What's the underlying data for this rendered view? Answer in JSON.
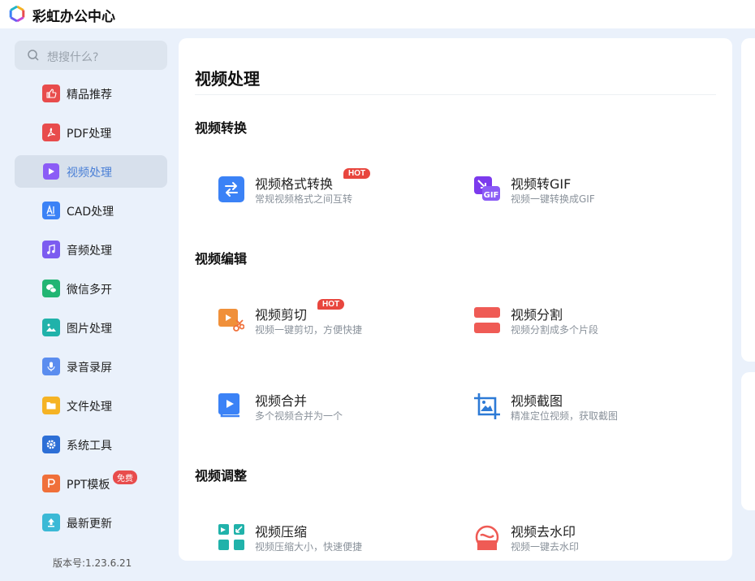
{
  "app": {
    "title": "彩虹办公中心"
  },
  "search": {
    "placeholder": "想搜什么?"
  },
  "sidebar": {
    "items": [
      {
        "label": "精品推荐",
        "icon": "thumbs-up-icon",
        "color": "#e84c4c"
      },
      {
        "label": "PDF处理",
        "icon": "pdf-icon",
        "color": "#e84c4c"
      },
      {
        "label": "视频处理",
        "icon": "video-play-icon",
        "color": "#8b5cf6"
      },
      {
        "label": "CAD处理",
        "icon": "cad-icon",
        "color": "#3b82f6"
      },
      {
        "label": "音频处理",
        "icon": "music-note-icon",
        "color": "#7c5cf0"
      },
      {
        "label": "微信多开",
        "icon": "wechat-icon",
        "color": "#22b573"
      },
      {
        "label": "图片处理",
        "icon": "image-icon",
        "color": "#20b2aa"
      },
      {
        "label": "录音录屏",
        "icon": "microphone-icon",
        "color": "#5b8def"
      },
      {
        "label": "文件处理",
        "icon": "folder-icon",
        "color": "#f5b324"
      },
      {
        "label": "系统工具",
        "icon": "gear-icon",
        "color": "#2d6fd6"
      },
      {
        "label": "PPT模板",
        "icon": "ppt-icon",
        "color": "#f0703a",
        "badge": "免费"
      },
      {
        "label": "最新更新",
        "icon": "upload-icon",
        "color": "#3bb9d6"
      }
    ],
    "active_index": 2
  },
  "version": "版本号:1.23.6.21",
  "main": {
    "title": "视频处理",
    "sections": [
      {
        "title": "视频转换",
        "tools": [
          {
            "name": "视频格式转换",
            "desc": "常规视频格式之间互转",
            "hot": "HOT",
            "icon": "convert-arrows-icon"
          },
          {
            "name": "视频转GIF",
            "desc": "视频一键转换成GIF",
            "icon": "gif-icon"
          }
        ]
      },
      {
        "title": "视频编辑",
        "tools": [
          {
            "name": "视频剪切",
            "desc": "视频一键剪切，方便快捷",
            "hot": "HOT",
            "icon": "video-cut-icon"
          },
          {
            "name": "视频分割",
            "desc": "视频分割成多个片段",
            "icon": "split-icon"
          },
          {
            "name": "视频合并",
            "desc": "多个视频合并为一个",
            "icon": "merge-icon"
          },
          {
            "name": "视频截图",
            "desc": "精准定位视频，获取截图",
            "icon": "crop-icon"
          }
        ]
      },
      {
        "title": "视频调整",
        "tools": [
          {
            "name": "视频压缩",
            "desc": "视频压缩大小，快速便捷",
            "icon": "compress-icon"
          },
          {
            "name": "视频去水印",
            "desc": "视频一键去水印",
            "icon": "watermark-remove-icon"
          }
        ]
      }
    ]
  }
}
